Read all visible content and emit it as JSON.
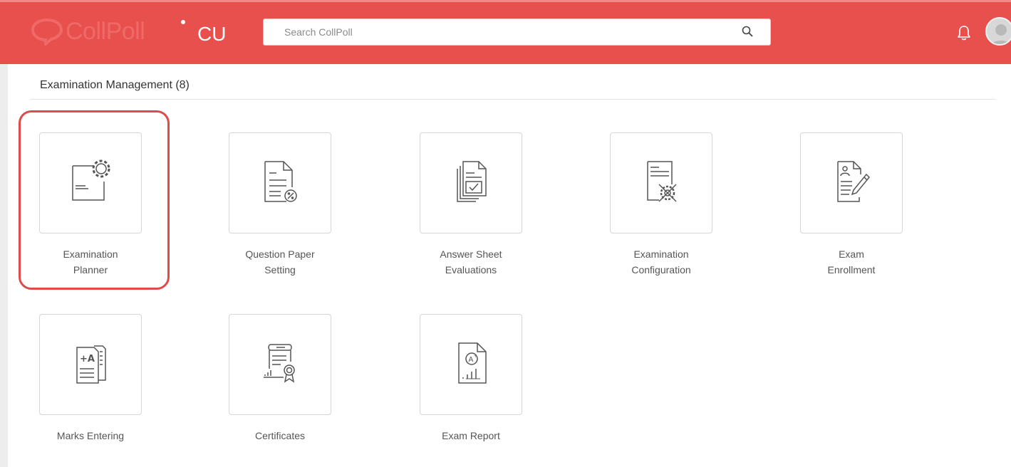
{
  "header": {
    "logo_text": "CollPoll",
    "institution_code": "CU",
    "search_placeholder": "Search CollPoll",
    "accent_color": "#e8504e"
  },
  "section": {
    "title": "Examination Management (8)"
  },
  "modules": [
    {
      "line1": "Examination",
      "line2": "Planner",
      "icon": "document-gear-icon",
      "highlighted": true
    },
    {
      "line1": "Question Paper",
      "line2": "Setting",
      "icon": "document-percent-icon"
    },
    {
      "line1": "Answer Sheet",
      "line2": "Evaluations",
      "icon": "stacked-documents-check-icon"
    },
    {
      "line1": "Examination",
      "line2": "Configuration",
      "icon": "document-tools-icon"
    },
    {
      "line1": "Exam",
      "line2": "Enrollment",
      "icon": "document-pen-icon"
    },
    {
      "line1": "Marks Entering",
      "line2": "",
      "icon": "grade-sheet-icon"
    },
    {
      "line1": "Certificates",
      "line2": "",
      "icon": "certificate-icon"
    },
    {
      "line1": "Exam Report",
      "line2": "",
      "icon": "report-chart-icon"
    }
  ],
  "highlight_color": "#e04a4a"
}
